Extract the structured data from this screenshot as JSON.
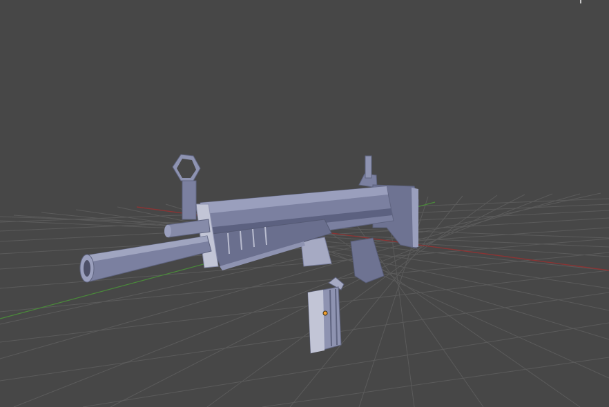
{
  "viewport": {
    "background": "#474747",
    "grid_color": "#5a5a5a",
    "x_axis_color": "#8a3434",
    "y_axis_color": "#4a8a3a",
    "model_color": "#7b80a0",
    "model_light": "#9a9fbd",
    "model_dark": "#5f6480",
    "model_highlight": "#b9bccf",
    "origin_color": "#f0a030"
  },
  "objects": [
    {
      "name": "Rifle",
      "icon": "mesh-icon"
    },
    {
      "name": "Magazine",
      "icon": "mesh-icon"
    }
  ]
}
